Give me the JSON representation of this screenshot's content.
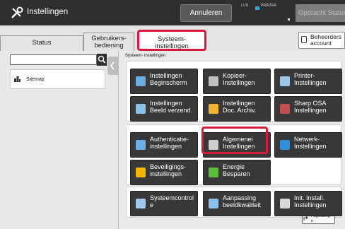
{
  "header": {
    "title": "Instellingen",
    "cancel_label": "Annuleren",
    "status_lin": "LIJN",
    "status_printer": "PRINTER",
    "job_status_label": "Opdracht Status"
  },
  "tabs": {
    "status": "Status",
    "users_line1": "Gebruikers-",
    "users_line2": "bediening",
    "system_line1": "Systeem-",
    "system_line2": "instellingen"
  },
  "admin": {
    "line1": "Beheerders",
    "line2": "account"
  },
  "sidebar": {
    "sitemap_label": "Sitemap",
    "search_placeholder": ""
  },
  "breadcrumb": "Systeem- instellingen",
  "buttons": [
    {
      "l1": "Instellingen",
      "l2": "Beginscherm",
      "icon": "home-icon"
    },
    {
      "l1": "Kopieer-",
      "l2": "Instellingen",
      "icon": "copy-icon"
    },
    {
      "l1": "Printer-",
      "l2": "Instellingen",
      "icon": "printer-icon"
    },
    {
      "l1": "Instellingen",
      "l2": "Beeld verzend.",
      "icon": "send-image-icon"
    },
    {
      "l1": "Instellingen",
      "l2": "Doc. Archiv.",
      "icon": "folder-icon"
    },
    {
      "l1": "Sharp OSA",
      "l2": "Instellingen",
      "icon": "osa-icon"
    },
    {
      "l1": "Authenticatie-",
      "l2": "instellingen",
      "icon": "users-icon"
    },
    {
      "l1": "Algemenei",
      "l2": "Instellingen",
      "icon": "general-settings-icon"
    },
    {
      "l1": "Netwerk-",
      "l2": "Instellingen",
      "icon": "network-icon"
    },
    {
      "l1": "Beveiligings-",
      "l2": "instellingen",
      "icon": "lock-icon"
    },
    {
      "l1": "Energie",
      "l2": "Besparen",
      "icon": "leaf-icon"
    },
    {
      "l1": "Systeemcontrol",
      "l2": "e",
      "icon": "system-control-icon"
    },
    {
      "l1": "Aanpassing",
      "l2": "beeldkwaliteit",
      "icon": "image-quality-icon"
    },
    {
      "l1": "Init. Install.",
      "l2": "Instellingen",
      "icon": "init-install-icon"
    }
  ],
  "page_button": {
    "line1": "Paginabegi",
    "line2": "n"
  },
  "colors": {
    "highlight": "#d51c3c",
    "button": "#383838",
    "topbar": "#2f2f2f"
  }
}
